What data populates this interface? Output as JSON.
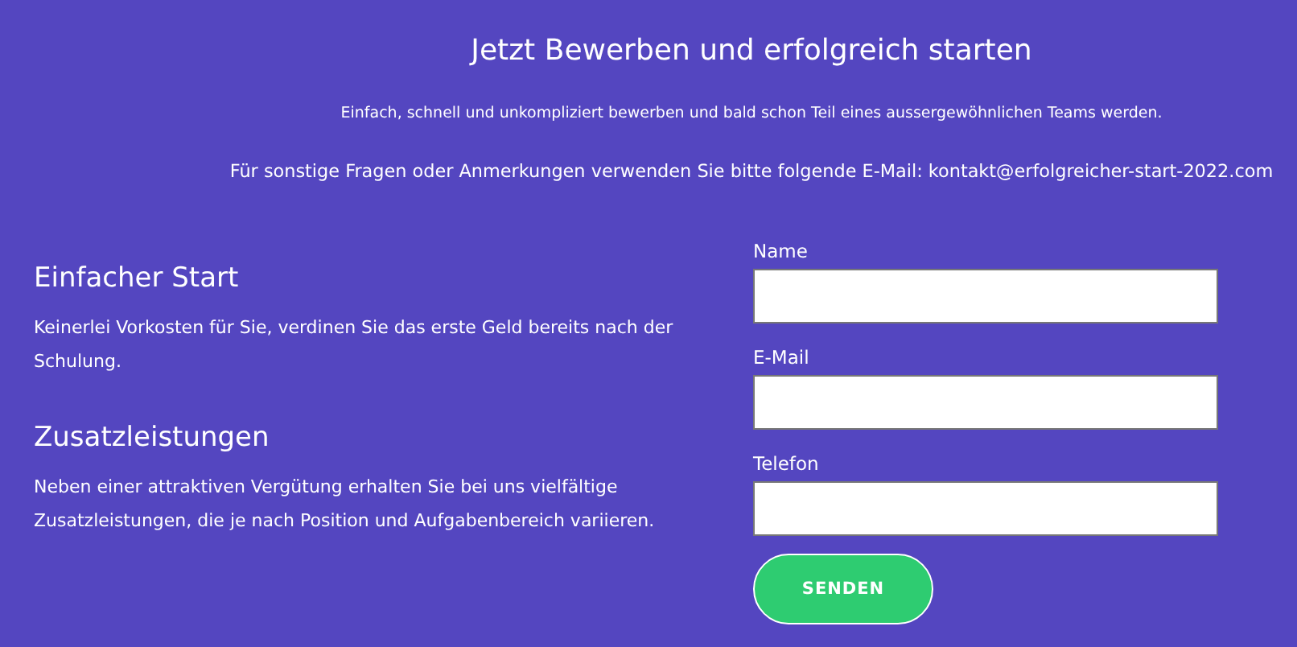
{
  "header": {
    "title": "Jetzt Bewerben und erfolgreich starten",
    "subtitle": "Einfach, schnell und unkompliziert bewerben und bald schon Teil eines aussergewöhnlichen Teams werden.",
    "contact": "Für sonstige Fragen oder Anmerkungen verwenden Sie bitte folgende E-Mail: kontakt@erfolgreicher-start-2022.com"
  },
  "features": [
    {
      "heading": "Einfacher Start",
      "text": "Keinerlei Vorkosten für Sie, verdinen Sie das erste Geld bereits nach der Schulung."
    },
    {
      "heading": "Zusatzleistungen",
      "text": "Neben einer attraktiven Vergütung erhalten Sie bei uns vielfältige Zusatzleistungen, die je nach Position und Aufgabenbereich variieren."
    }
  ],
  "form": {
    "fields": [
      {
        "label": "Name"
      },
      {
        "label": "E-Mail"
      },
      {
        "label": "Telefon"
      }
    ],
    "submit": "SENDEN"
  }
}
